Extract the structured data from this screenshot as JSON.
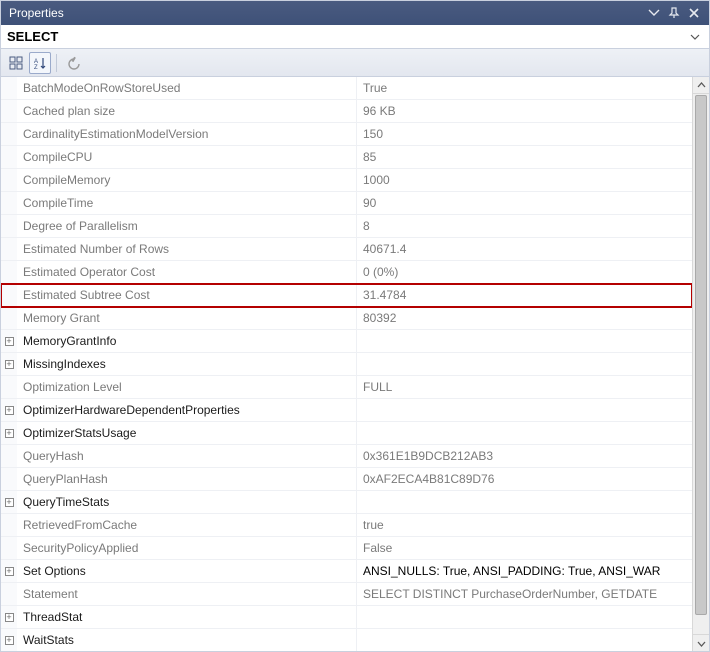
{
  "window": {
    "title": "Properties"
  },
  "object": {
    "name": "SELECT"
  },
  "toolbar": {
    "categorized": "Categorized",
    "alphabetical": "Alphabetical",
    "propertypages": "Property Pages"
  },
  "rows": [
    {
      "name": "BatchModeOnRowStoreUsed",
      "value": "True",
      "ro": true
    },
    {
      "name": "Cached plan size",
      "value": "96 KB",
      "ro": true
    },
    {
      "name": "CardinalityEstimationModelVersion",
      "value": "150",
      "ro": true
    },
    {
      "name": "CompileCPU",
      "value": "85",
      "ro": true
    },
    {
      "name": "CompileMemory",
      "value": "1000",
      "ro": true
    },
    {
      "name": "CompileTime",
      "value": "90",
      "ro": true
    },
    {
      "name": "Degree of Parallelism",
      "value": "8",
      "ro": true
    },
    {
      "name": "Estimated Number of Rows",
      "value": "40671.4",
      "ro": true
    },
    {
      "name": "Estimated Operator Cost",
      "value": "0 (0%)",
      "ro": true
    },
    {
      "name": "Estimated Subtree Cost",
      "value": "31.4784",
      "ro": true,
      "hl": true
    },
    {
      "name": "Memory Grant",
      "value": "80392",
      "ro": true
    },
    {
      "name": "MemoryGrantInfo",
      "value": "",
      "expandable": true
    },
    {
      "name": "MissingIndexes",
      "value": "",
      "expandable": true
    },
    {
      "name": "Optimization Level",
      "value": "FULL",
      "ro": true
    },
    {
      "name": "OptimizerHardwareDependentProperties",
      "value": "",
      "expandable": true
    },
    {
      "name": "OptimizerStatsUsage",
      "value": "",
      "expandable": true
    },
    {
      "name": "QueryHash",
      "value": "0x361E1B9DCB212AB3",
      "ro": true
    },
    {
      "name": "QueryPlanHash",
      "value": "0xAF2ECA4B81C89D76",
      "ro": true
    },
    {
      "name": "QueryTimeStats",
      "value": "",
      "expandable": true
    },
    {
      "name": "RetrievedFromCache",
      "value": "true",
      "ro": true
    },
    {
      "name": "SecurityPolicyApplied",
      "value": "False",
      "ro": true
    },
    {
      "name": "Set Options",
      "value": "ANSI_NULLS: True, ANSI_PADDING: True, ANSI_WAR",
      "expandable": true
    },
    {
      "name": "Statement",
      "value": "SELECT DISTINCT PurchaseOrderNumber, GETDATE",
      "ro": true
    },
    {
      "name": "ThreadStat",
      "value": "",
      "expandable": true
    },
    {
      "name": "WaitStats",
      "value": "",
      "expandable": true
    }
  ],
  "scroll": {
    "thumbTop": 18,
    "thumbHeight": 520
  }
}
